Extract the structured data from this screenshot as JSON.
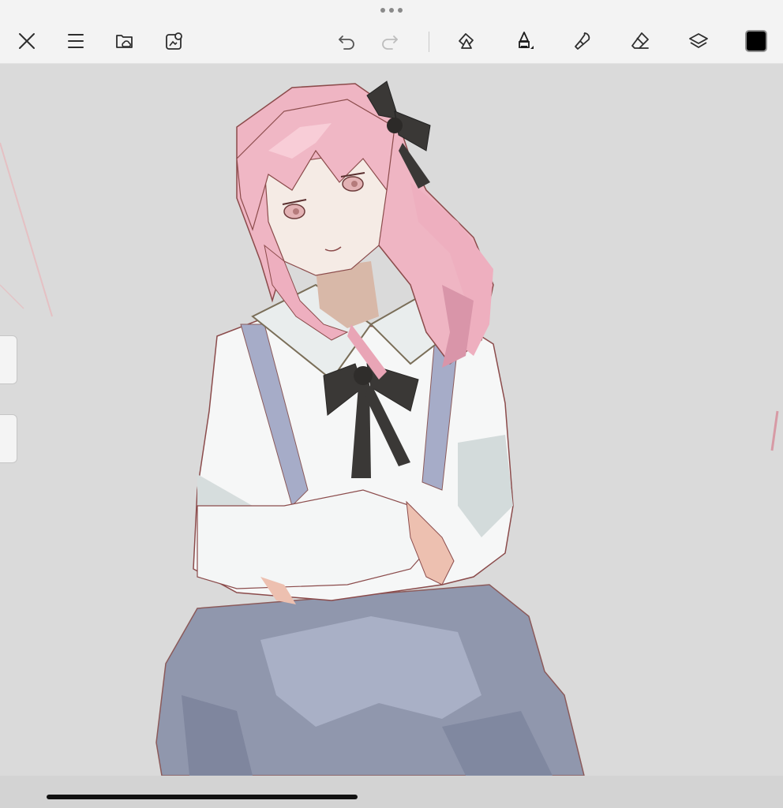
{
  "toolbar": {
    "buttons": [
      {
        "name": "close-icon"
      },
      {
        "name": "menu-icon"
      },
      {
        "name": "gallery-folder-icon"
      },
      {
        "name": "new-canvas-icon"
      },
      {
        "name": "undo-icon"
      },
      {
        "name": "redo-icon"
      },
      {
        "name": "selection-icon"
      },
      {
        "name": "brush-pen-icon"
      },
      {
        "name": "smudge-icon"
      },
      {
        "name": "eraser-icon"
      },
      {
        "name": "layers-icon"
      }
    ],
    "current_color": "#000000"
  },
  "canvas": {
    "background": "#dadada",
    "artwork_description_icon": "anime-girl-illustration"
  },
  "colors": {
    "hair": "#eeb3c2",
    "hair_shadow": "#d98fa6",
    "skin": "#f3e6df",
    "shirt": "#f6f7f7",
    "shirt_shadow": "#c9d3d3",
    "dress": "#8f97ad",
    "dress_light": "#a9b1c6",
    "ribbon": "#3a3836",
    "outline": "#8b4b4b"
  }
}
